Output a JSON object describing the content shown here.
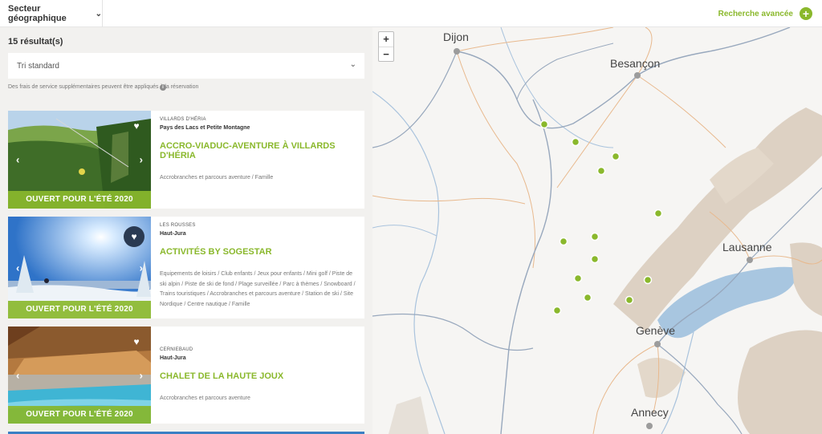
{
  "topbar": {
    "sector_label": "Secteur géographique",
    "advanced_label": "Recherche avancée"
  },
  "results": {
    "count_label": "15 résultat(s)",
    "sort_value": "Tri standard",
    "fee_note": "Des frais de service supplémentaires peuvent être appliqués à la réservation"
  },
  "cards": [
    {
      "town": "Villards d'Héria",
      "region": "Pays des Lacs et Petite Montagne",
      "title": "Accro-viaduc-aventure à Villards d'Héria",
      "tags": "Accrobranches et parcours aventure / Famille",
      "banner": "OUVERT POUR L'ÉTÉ 2020"
    },
    {
      "town": "Les Rousses",
      "region": "Haut-Jura",
      "title": "Activités by Sogestar",
      "tags": "Equipements de loisirs / Club enfants / Jeux pour enfants / Mini golf / Piste de ski alpin / Piste de ski de fond / Plage surveillée / Parc à thèmes / Snowboard / Trains touristiques / Accrobranches et parcours aventure / Station de ski / Site Nordique / Centre nautique / Famille",
      "banner": "OUVERT POUR L'ÉTÉ 2020"
    },
    {
      "town": "Cerniebaud",
      "region": "Haut-Jura",
      "title": "Chalet de la Haute Joux",
      "tags": "Accrobranches et parcours aventure",
      "banner": "OUVERT POUR L'ÉTÉ 2020"
    }
  ],
  "map": {
    "zoom_in": "+",
    "zoom_out": "−",
    "cities": [
      "Dijon",
      "Besançon",
      "Lausanne",
      "Genève",
      "Annecy"
    ],
    "marker_count": 13,
    "marker_color": "#8ab82c"
  },
  "colors": {
    "accent": "#8ab82c",
    "background": "#f2f1ef"
  }
}
